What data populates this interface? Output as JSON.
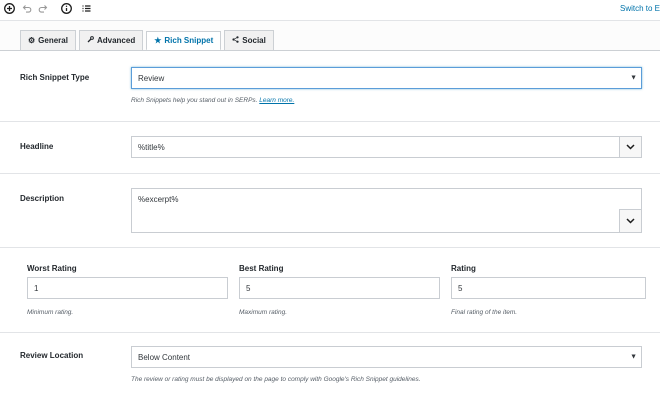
{
  "toolbar": {
    "icons": [
      "add-circle-icon",
      "undo-icon",
      "redo-icon",
      "info-icon",
      "list-icon"
    ],
    "switch_link": "Switch to E"
  },
  "tabs": [
    {
      "label": "General",
      "icon": "gear-icon"
    },
    {
      "label": "Advanced",
      "icon": "wrench-icon"
    },
    {
      "label": "Rich Snippet",
      "icon": "star-icon",
      "active": true
    },
    {
      "label": "Social",
      "icon": "share-icon"
    }
  ],
  "rich_snippet_type": {
    "label": "Rich Snippet Type",
    "value": "Review",
    "help_text": "Rich Snippets help you stand out in SERPs.",
    "help_link": "Learn more."
  },
  "headline": {
    "label": "Headline",
    "value": "%title%"
  },
  "description": {
    "label": "Description",
    "value": "%excerpt%"
  },
  "ratings": {
    "worst": {
      "label": "Worst Rating",
      "value": "1",
      "help": "Minimum rating."
    },
    "best": {
      "label": "Best Rating",
      "value": "5",
      "help": "Maximum rating."
    },
    "rating": {
      "label": "Rating",
      "value": "5",
      "help": "Final rating of the item."
    }
  },
  "review_location": {
    "label": "Review Location",
    "value": "Below Content",
    "help": "The review or rating must be displayed on the page to comply with Google's Rich Snippet guidelines."
  },
  "colors": {
    "accent": "#0073aa",
    "focus_border": "#5b9dd9"
  }
}
